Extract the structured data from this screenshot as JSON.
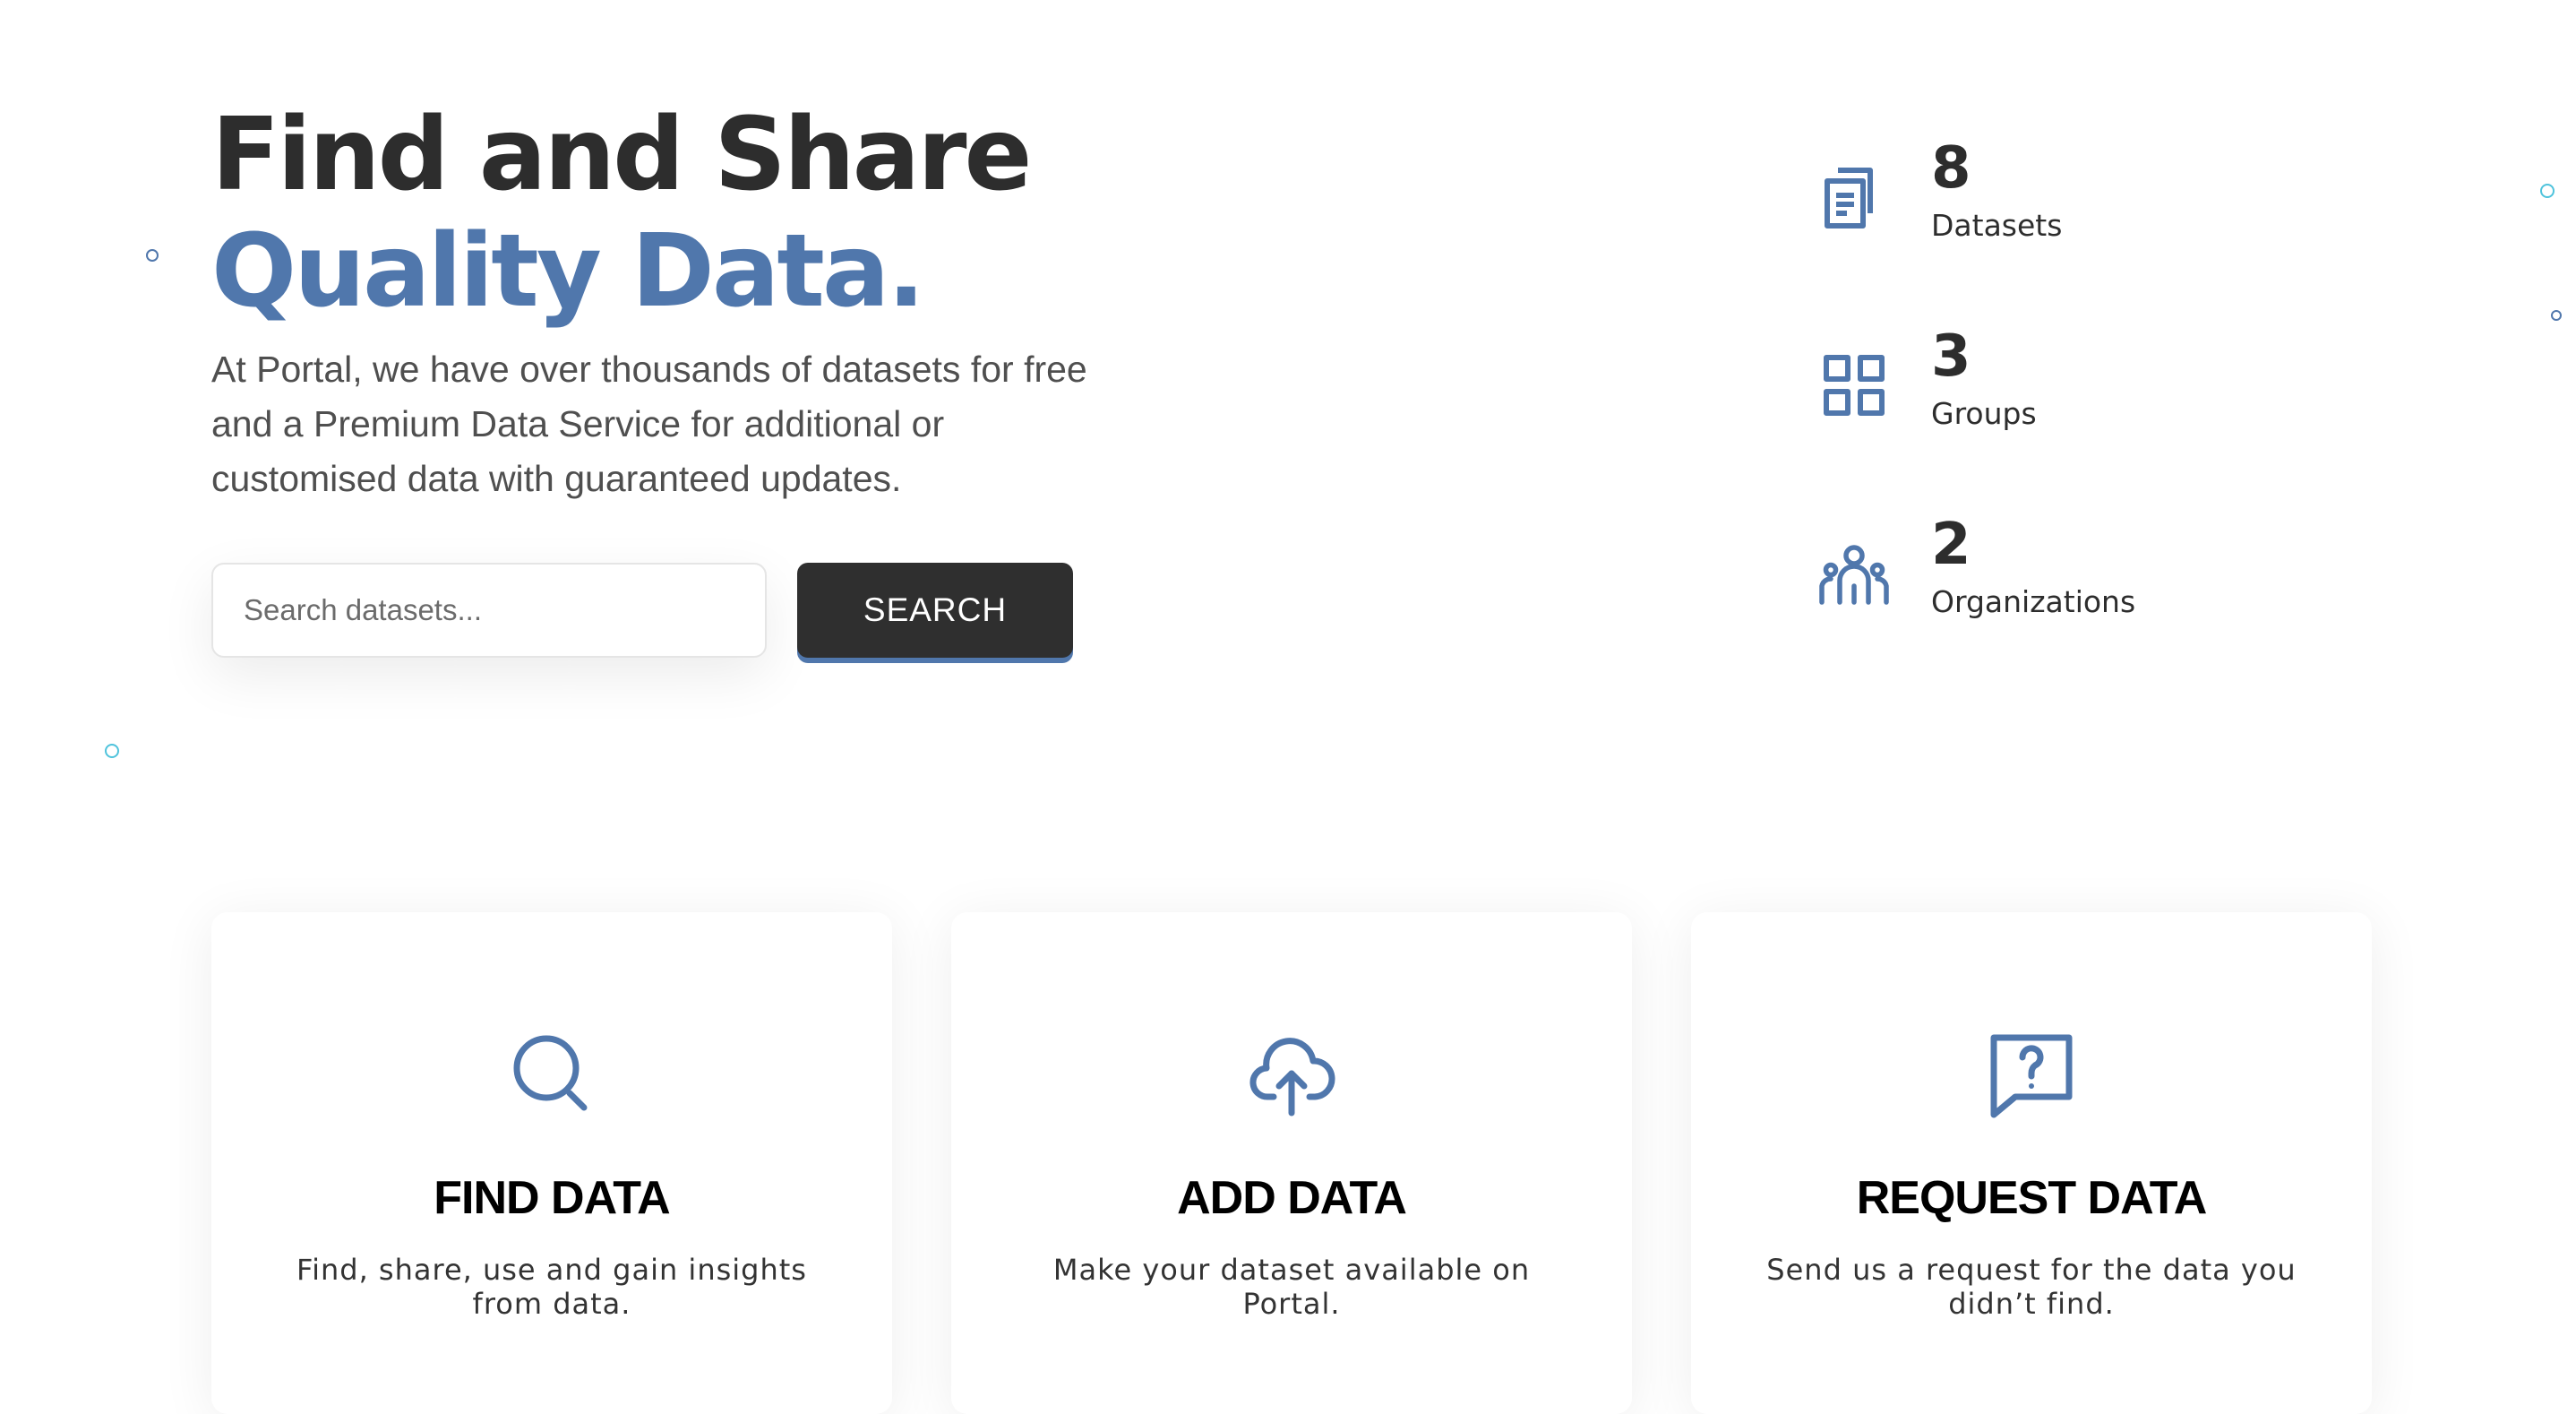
{
  "hero": {
    "title_line1": "Find and Share",
    "title_line2": "Quality Data.",
    "description": "At Portal, we have over thousands of datasets for free and a Premium Data Service for additional or customised data with guaranteed updates."
  },
  "search": {
    "placeholder": "Search datasets...",
    "value": "",
    "button_label": "SEARCH"
  },
  "stats": [
    {
      "icon": "documents-icon",
      "value": "8",
      "label": "Datasets"
    },
    {
      "icon": "grid-icon",
      "value": "3",
      "label": "Groups"
    },
    {
      "icon": "people-icon",
      "value": "2",
      "label": "Organizations"
    }
  ],
  "cards": [
    {
      "icon": "search-icon",
      "title": "FIND DATA",
      "text": "Find, share, use and gain insights from data."
    },
    {
      "icon": "cloud-upload-icon",
      "title": "ADD DATA",
      "text": "Make your dataset available on Portal."
    },
    {
      "icon": "question-message-icon",
      "title": "REQUEST DATA",
      "text": "Send us a request for the data you didn’t find."
    }
  ],
  "colors": {
    "accent": "#5077ac",
    "dark": "#2f2f2f",
    "decoration": "#4fc3dc"
  }
}
